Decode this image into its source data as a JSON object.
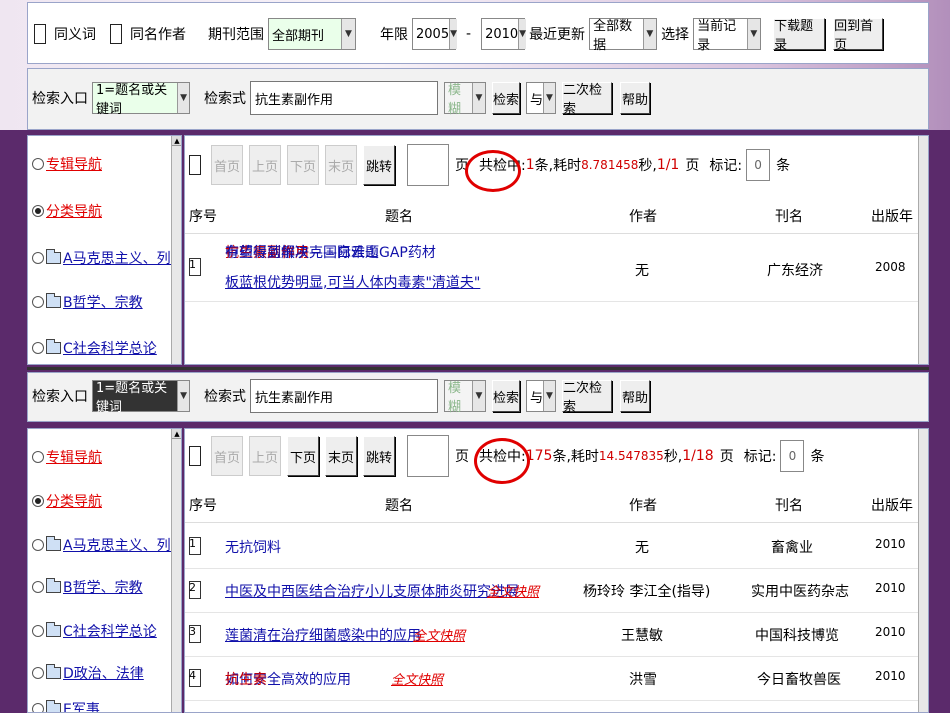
{
  "top_bar": {
    "synonym_label": "同义词",
    "same_author_label": "同名作者",
    "journal_range_label": "期刊范围",
    "journal_range_value": "全部期刊",
    "year_label": "年限",
    "year_from": "2005",
    "dash": "-",
    "year_to": "2010",
    "recent_update_label": "最近更新",
    "recent_update_value": "全部数据",
    "select_label": "选择",
    "select_value": "当前记录",
    "download_button": "下载题录",
    "back_button": "回到首页"
  },
  "search_1": {
    "entry_label": "检索入口",
    "entry_value": "1=题名或关键词",
    "query_label": "检索式",
    "query_value": "抗生素副作用",
    "fuzzy": "模糊",
    "search_button": "检索",
    "logic": "与",
    "secondary_button": "二次检索",
    "help_button": "帮助"
  },
  "nav": {
    "items": [
      {
        "label": "专辑导航",
        "style": "red"
      },
      {
        "label": "分类导航",
        "style": "red"
      },
      {
        "label": "A马克思主义、列宁主",
        "style": "blue"
      },
      {
        "label": "B哲学、宗教",
        "style": "blue"
      },
      {
        "label": "C社会科学总论",
        "style": "blue"
      },
      {
        "label": "D政治、法律",
        "style": "blue"
      },
      {
        "label": "E军事",
        "style": "blue"
      }
    ]
  },
  "result_1": {
    "first": "首页",
    "prev": "上页",
    "next": "下页",
    "last": "末页",
    "jump": "跳转",
    "page_unit": "页",
    "total_prefix": "共检中:",
    "total_count": "1",
    "total_suffix": "条,耗时",
    "time": "8.781458",
    "sec": "秒,",
    "pages": "1/1",
    "page_word": "页",
    "mark_label": "标记:",
    "mark_value": "0",
    "mark_unit": "条",
    "headers": {
      "no": "序号",
      "title": "题名",
      "author": "作者",
      "journal": "刊名",
      "year": "出版年"
    },
    "rows": [
      {
        "no": "1",
        "title_pre": "中药板蓝根攻克国际难题",
        "title_hl": "抗生素副作用",
        "title_post": "有望得到解决——白云山GAP药材",
        "title_line2": "板蓝根优势明显,可当人体内毒素\"清道夫\"",
        "author": "无",
        "journal": "广东经济",
        "year": "2008"
      }
    ]
  },
  "search_2": {
    "entry_label": "检索入口",
    "entry_value": "1=题名或关键词",
    "query_label": "检索式",
    "query_value": "抗生素副作用",
    "fuzzy": "模糊",
    "search_button": "检索",
    "logic": "与",
    "secondary_button": "二次检索",
    "help_button": "帮助"
  },
  "result_2": {
    "first": "首页",
    "prev": "上页",
    "next": "下页",
    "last": "末页",
    "jump": "跳转",
    "page_unit": "页",
    "total_prefix": "共检中:",
    "total_count": "175",
    "total_suffix": "条,耗时",
    "time": "14.547835",
    "sec": "秒,",
    "pages": "1/18",
    "page_word": "页",
    "mark_label": "标记:",
    "mark_value": "0",
    "mark_unit": "条",
    "headers": {
      "no": "序号",
      "title": "题名",
      "author": "作者",
      "journal": "刊名",
      "year": "出版年"
    },
    "fulltext_label": "全文快照",
    "rows": [
      {
        "no": "1",
        "title_pre": "无抗饲料",
        "title_hl": "",
        "title_post": "",
        "fulltext": false,
        "author": "无",
        "journal": "畜禽业",
        "year": "2010"
      },
      {
        "no": "2",
        "title_pre": "中医及中西医结合治疗小儿支原体肺炎研究进展",
        "title_hl": "",
        "title_post": "",
        "fulltext": true,
        "author": "杨玲玲 李江全(指导)",
        "journal": "实用中医药杂志",
        "year": "2010"
      },
      {
        "no": "3",
        "title_pre": "莲菌清在治疗细菌感染中的应用",
        "title_hl": "",
        "title_post": "",
        "fulltext": true,
        "author": "王慧敏",
        "journal": "中国科技博览",
        "year": "2010"
      },
      {
        "no": "4",
        "title_pre": "如何安全高效的应用",
        "title_hl": "抗生素",
        "title_post": "",
        "fulltext": true,
        "author": "洪雪",
        "journal": "今日畜牧兽医",
        "year": "2010"
      }
    ]
  },
  "colors": {
    "background": "#5b2a6b",
    "highlight": "#d00000",
    "link": "#1111aa",
    "select_bg": "#eaffea"
  }
}
